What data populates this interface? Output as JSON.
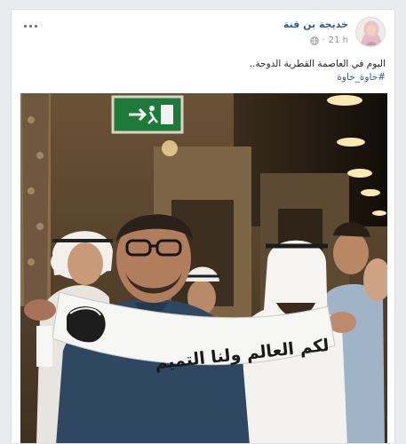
{
  "post": {
    "author": "خديجة بن قنة",
    "time": "21 h",
    "privacy_icon": "globe-icon",
    "text_line1": "اليوم في العاصمة القطرية الدوحة..",
    "hashtag": "#خاوة_خاوة",
    "menu_icon": "more-options-icon"
  },
  "photo": {
    "scarf_text": "لكم العالم ولنا التميم",
    "exit_sign_icon": "exit-sign-icon"
  },
  "colors": {
    "background": "#e9ebee",
    "link": "#365899",
    "meta": "#90949c",
    "text": "#1d2129"
  }
}
